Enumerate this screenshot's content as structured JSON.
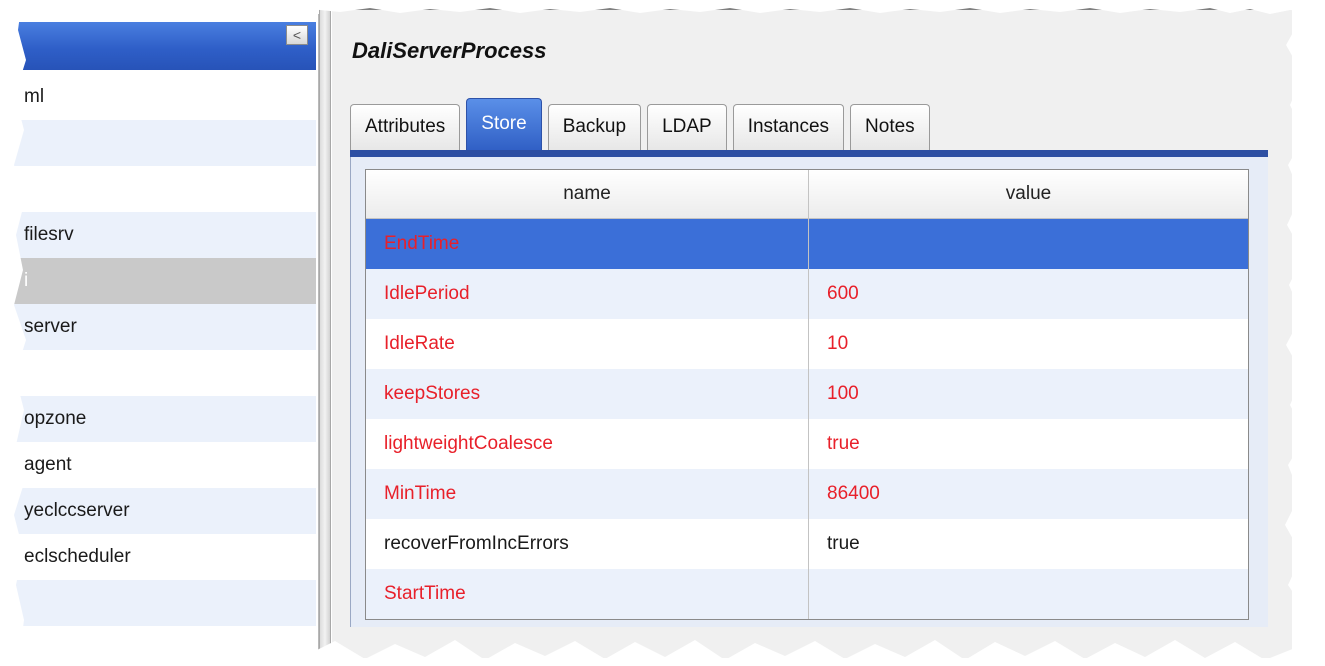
{
  "left_panel": {
    "collapse_glyph": "<",
    "items": [
      {
        "label": "ml"
      },
      {
        "label": ""
      },
      {
        "label": ""
      },
      {
        "label": "filesrv"
      },
      {
        "label": "i"
      },
      {
        "label": "server"
      },
      {
        "label": ""
      },
      {
        "label": "opzone"
      },
      {
        "label": "agent"
      },
      {
        "label": "yeclccserver"
      },
      {
        "label": "eclscheduler"
      },
      {
        "label": ""
      }
    ]
  },
  "detail": {
    "title": "DaliServerProcess",
    "tabs": [
      {
        "label": "Attributes"
      },
      {
        "label": "Store"
      },
      {
        "label": "Backup"
      },
      {
        "label": "LDAP"
      },
      {
        "label": "Instances"
      },
      {
        "label": "Notes"
      }
    ],
    "active_tab": "Store",
    "table": {
      "columns": [
        "name",
        "value"
      ],
      "rows": [
        {
          "name": "EndTime",
          "value": "",
          "highlight": "red"
        },
        {
          "name": "IdlePeriod",
          "value": "600",
          "highlight": "red"
        },
        {
          "name": "IdleRate",
          "value": "10",
          "highlight": "red"
        },
        {
          "name": "keepStores",
          "value": "100",
          "highlight": "red"
        },
        {
          "name": "lightweightCoalesce",
          "value": "true",
          "highlight": "red"
        },
        {
          "name": "MinTime",
          "value": "86400",
          "highlight": "red"
        },
        {
          "name": "recoverFromIncErrors",
          "value": "true",
          "highlight": "black"
        },
        {
          "name": "StartTime",
          "value": "",
          "highlight": "red"
        }
      ],
      "selected_row": "EndTime"
    }
  },
  "colors": {
    "accent_blue": "#2d4fa3",
    "selected_row": "#3b6fd8",
    "modified_text": "#e8202a"
  }
}
